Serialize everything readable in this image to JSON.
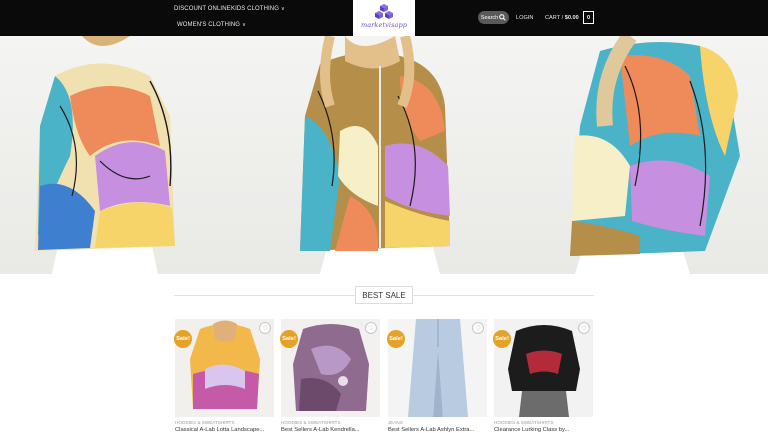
{
  "header": {
    "nav": [
      {
        "label": "DISCOUNT ONLINE",
        "dropdown": false
      },
      {
        "label": "KIDS CLOTHING",
        "dropdown": true
      },
      {
        "label": "WOMEN'S CLOTHING",
        "dropdown": true
      }
    ],
    "logo_text": "marketvisapp",
    "search_label": "Search",
    "login_label": "LOGIN",
    "cart_label": "CART /",
    "cart_total": "$0.00",
    "cart_count": "0"
  },
  "section": {
    "title": "BEST SALE"
  },
  "products": [
    {
      "badge": "Sale!",
      "category": "HOODIES & SWEATSHIRTS",
      "title": "Classical A-Lab Lotta Landscape..."
    },
    {
      "badge": "Sale!",
      "category": "HOODIES & SWEATSHIRTS",
      "title": "Best Sellers A-Lab Kendrella..."
    },
    {
      "badge": "Sale!",
      "category": "JEANS",
      "title": "Best Sellers A-Lab Ashlyn Extra..."
    },
    {
      "badge": "Sale!",
      "category": "HOODIES & SWEATSHIRTS",
      "title": "Clearance Lurking Class by..."
    }
  ],
  "icons": {
    "search": "search-icon",
    "wishlist": "heart-icon",
    "chevron": "chevron-down-icon"
  },
  "colors": {
    "header_bg": "#0a0a0a",
    "sale_badge": "#e4a227",
    "logo_accent": "#6a4fc8"
  }
}
